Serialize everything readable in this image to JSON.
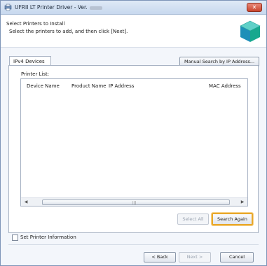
{
  "window": {
    "title": "UFRII LT Printer Driver - Ver.",
    "close_glyph": "✕"
  },
  "header": {
    "title": "Select Printers to Install",
    "subtitle": "Select the printers to add, and then click [Next].",
    "icon": "printer-cube-icon"
  },
  "tabs": [
    {
      "label": "IPv4 Devices"
    }
  ],
  "manual_search_label": "Manual Search by IP Address...",
  "printer_list": {
    "label": "Printer List:",
    "columns": [
      "Device Name",
      "Product Name",
      "IP Address",
      "MAC Address"
    ],
    "rows": []
  },
  "buttons": {
    "select_all": "Select All",
    "search_again": "Search Again",
    "back": "< Back",
    "next": "Next >",
    "cancel": "Cancel"
  },
  "set_printer_info": {
    "label": "Set Printer Information",
    "checked": false
  },
  "colors": {
    "accent_focus": "#e8a82b",
    "title_bar": "#c7d8ee",
    "close": "#c9442c"
  }
}
